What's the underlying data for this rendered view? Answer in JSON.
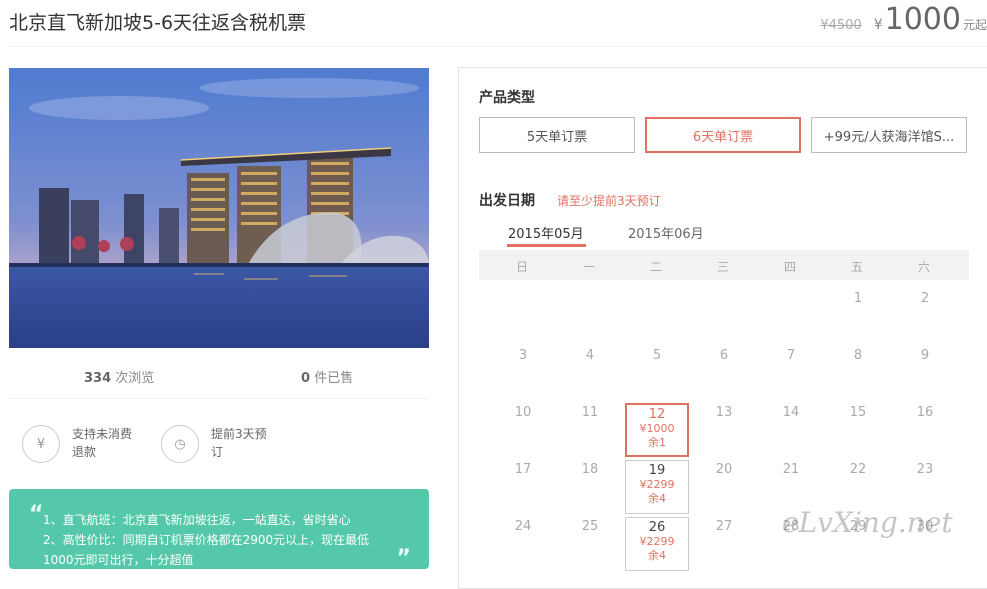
{
  "product": {
    "title": "北京直飞新加坡5-6天往返含税机票",
    "original_price": "¥4500",
    "currency": "¥",
    "price": "1000",
    "unit": "元起"
  },
  "stats": {
    "views_count": "334",
    "views_label": "次浏览",
    "sold_count": "0",
    "sold_label": "件已售"
  },
  "features": [
    {
      "icon": "refund-yen-icon",
      "glyph": "¥",
      "text": "支持未消费退款"
    },
    {
      "icon": "clock-history-icon",
      "glyph": "◷",
      "text": "提前3天预订"
    }
  ],
  "highlights": {
    "line1": "1、直飞航班：北京直飞新加坡往返，一站直达，省时省心",
    "line2": "2、高性价比：同期自订机票价格都在2900元以上，现在最低",
    "line3": "1000元即可出行，十分超值"
  },
  "booking": {
    "product_type_title": "产品类型",
    "types": [
      "5天单订票",
      "6天单订票",
      "+99元/人获海洋馆S..."
    ],
    "date_title": "出发日期",
    "date_hint": "请至少提前3天预订",
    "months": [
      "2015年05月",
      "2015年06月"
    ],
    "weekdays": [
      "日",
      "一",
      "二",
      "三",
      "四",
      "五",
      "六"
    ],
    "days": {
      "d1": "1",
      "d2": "2",
      "d3": "3",
      "d4": "4",
      "d5": "5",
      "d6": "6",
      "d7": "7",
      "d8": "8",
      "d9": "9",
      "d10": "10",
      "d11": "11",
      "d12": "12",
      "d13": "13",
      "d14": "14",
      "d15": "15",
      "d16": "16",
      "d17": "17",
      "d18": "18",
      "d19": "19",
      "d20": "20",
      "d21": "21",
      "d22": "22",
      "d23": "23",
      "d24": "24",
      "d25": "25",
      "d26": "26",
      "d27": "27",
      "d28": "28",
      "d29": "29",
      "d30": "30"
    },
    "availability": {
      "d12": {
        "price": "¥1000",
        "left": "余1"
      },
      "d19": {
        "price": "¥2299",
        "left": "余4"
      },
      "d26": {
        "price": "¥2299",
        "left": "余4"
      }
    }
  },
  "watermark": "eLvXing.net",
  "colors": {
    "accent": "#e2715f",
    "green": "#55c8aa"
  }
}
